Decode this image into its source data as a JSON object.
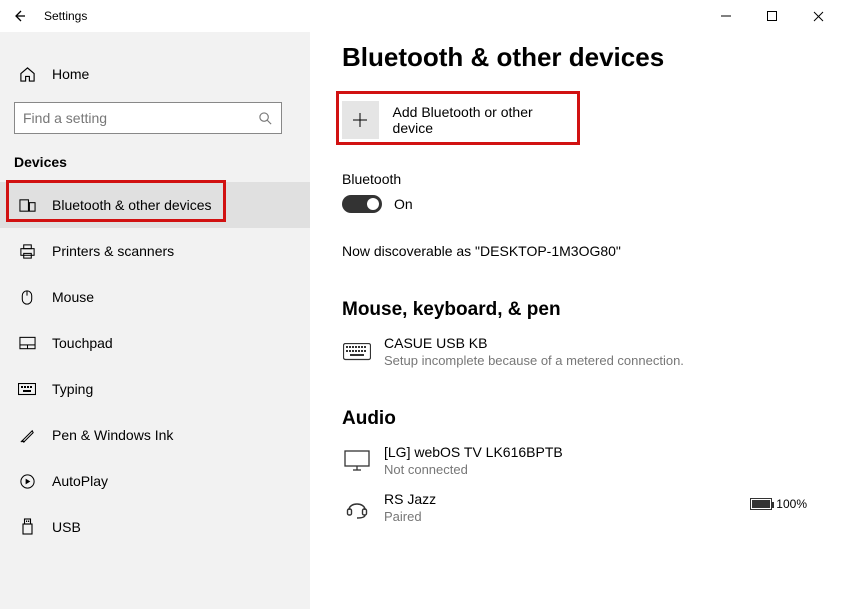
{
  "titlebar": {
    "app_title": "Settings"
  },
  "sidebar": {
    "home_label": "Home",
    "search_placeholder": "Find a setting",
    "section_label": "Devices",
    "items": [
      {
        "label": "Bluetooth & other devices"
      },
      {
        "label": "Printers & scanners"
      },
      {
        "label": "Mouse"
      },
      {
        "label": "Touchpad"
      },
      {
        "label": "Typing"
      },
      {
        "label": "Pen & Windows Ink"
      },
      {
        "label": "AutoPlay"
      },
      {
        "label": "USB"
      }
    ]
  },
  "main": {
    "page_title": "Bluetooth & other devices",
    "add_label": "Add Bluetooth or other device",
    "bt_label": "Bluetooth",
    "toggle_state": "On",
    "discoverable_text": "Now discoverable as \"DESKTOP-1M3OG80\"",
    "mouse_heading": "Mouse, keyboard, & pen",
    "dev_kb_name": "CASUE USB KB",
    "dev_kb_status": "Setup incomplete because of a metered connection.",
    "audio_heading": "Audio",
    "dev_tv_name": "[LG] webOS TV LK616BPTB",
    "dev_tv_status": "Not connected",
    "dev_headset_name": "RS Jazz",
    "dev_headset_status": "Paired",
    "battery_pct": "100%"
  }
}
